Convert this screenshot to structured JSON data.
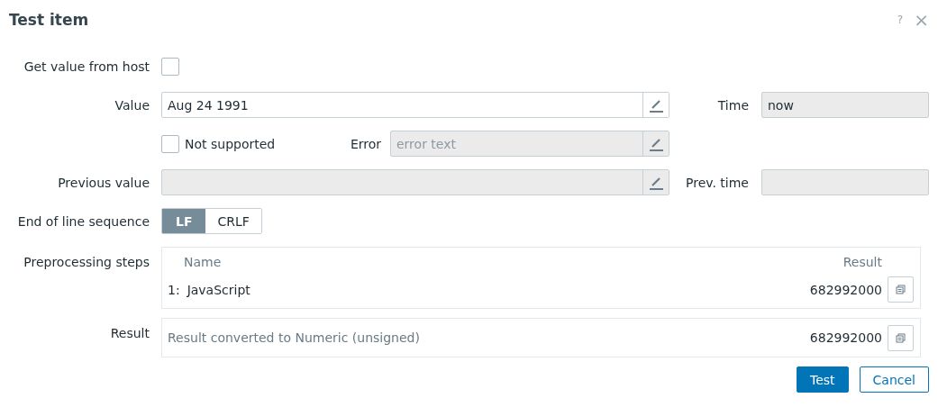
{
  "window": {
    "title": "Test item",
    "help": "?",
    "close": "×"
  },
  "get_value_from_host": {
    "label": "Get value from host",
    "checked": false
  },
  "value": {
    "label": "Value",
    "value": "Aug 24 1991",
    "disabled": false
  },
  "time": {
    "label": "Time",
    "value": "now"
  },
  "not_supported": {
    "label": "Not supported",
    "checked": false
  },
  "error": {
    "label": "Error",
    "placeholder": "error text",
    "disabled": true
  },
  "previous_value": {
    "label": "Previous value",
    "disabled": true
  },
  "prev_time": {
    "label": "Prev. time"
  },
  "eol": {
    "label": "End of line sequence",
    "options": [
      {
        "label": "LF",
        "selected": true
      },
      {
        "label": "CRLF",
        "selected": false
      }
    ]
  },
  "preprocessing": {
    "label": "Preprocessing steps",
    "columns": [
      "Name",
      "Result"
    ],
    "rows": [
      {
        "index": "1:",
        "name": "JavaScript",
        "result": "682992000"
      }
    ]
  },
  "result": {
    "label": "Result",
    "note": "Result converted to Numeric (unsigned)",
    "value": "682992000"
  },
  "buttons": [
    {
      "label": "Test",
      "kind": "primary"
    },
    {
      "label": "Cancel",
      "kind": "secondary"
    }
  ]
}
